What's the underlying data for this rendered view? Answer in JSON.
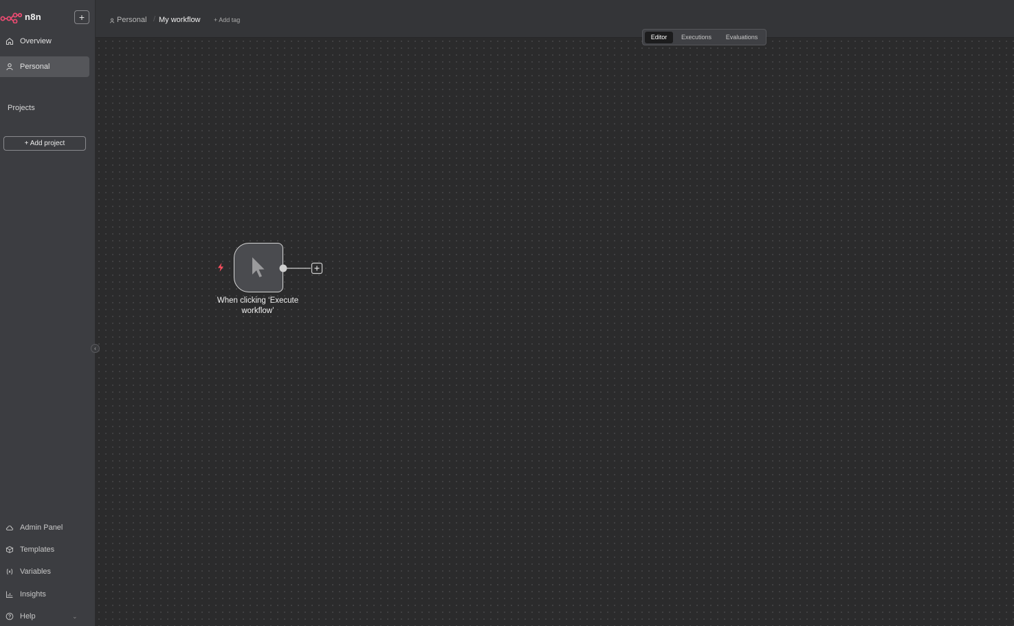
{
  "app": {
    "name": "n8n",
    "new_label": "+"
  },
  "sidebar": {
    "nav": [
      {
        "label": "Overview",
        "icon": "home-icon"
      },
      {
        "label": "Personal",
        "icon": "user-icon"
      }
    ],
    "projects_title": "Projects",
    "add_project_label": "+ Add project",
    "bottom": [
      {
        "label": "Admin Panel",
        "icon": "cloud-icon"
      },
      {
        "label": "Templates",
        "icon": "box-icon"
      },
      {
        "label": "Variables",
        "icon": "variables-icon"
      },
      {
        "label": "Insights",
        "icon": "bar-chart-icon"
      },
      {
        "label": "Help",
        "icon": "help-icon"
      }
    ],
    "collapse_glyph": "‹"
  },
  "header": {
    "breadcrumb_project": "Personal",
    "breadcrumb_sep": "/",
    "workflow_name": "My workflow",
    "add_tag": "+ Add tag",
    "tabs": [
      "Editor",
      "Executions",
      "Evaluations"
    ],
    "active_tab": "Editor"
  },
  "canvas": {
    "node": {
      "label": "When clicking ‘Execute workflow’",
      "icon": "cursor-icon",
      "trigger_icon": "bolt-icon"
    }
  },
  "colors": {
    "brand": "#ea4b71",
    "trigger": "#ff4d5e",
    "canvas": "#2b2b2c",
    "sidebar": "#3c3d41"
  }
}
